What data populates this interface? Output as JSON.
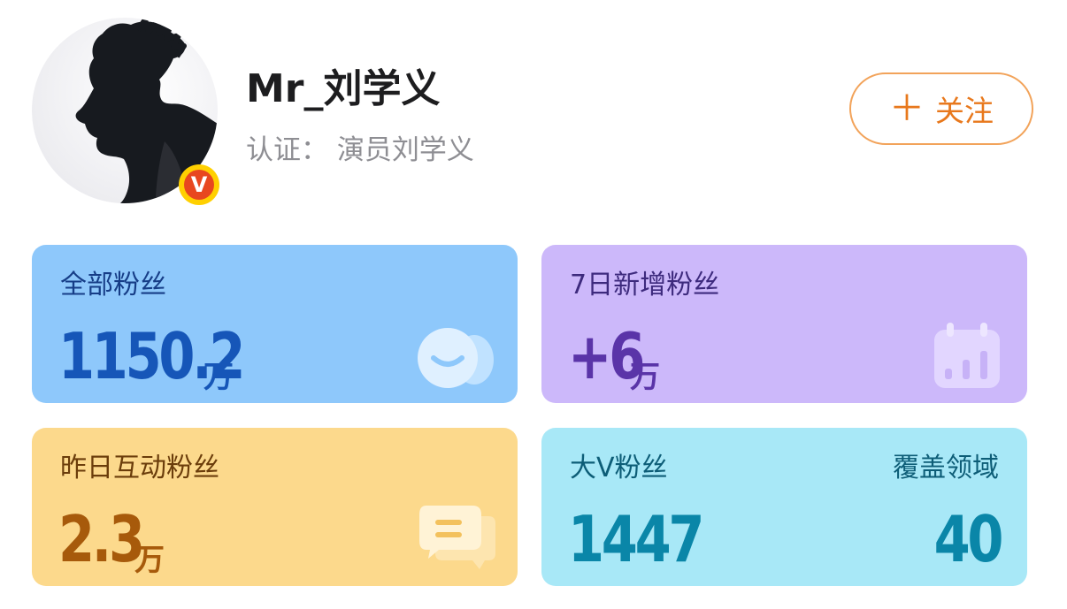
{
  "profile": {
    "name": "Mr_刘学义",
    "verification": "认证：  演员刘学义",
    "badge": "V",
    "follow_label": "关注",
    "follow_icon": "plus-icon"
  },
  "stats": {
    "total_fans": {
      "label": "全部粉丝",
      "value": "1150.2",
      "unit": "万",
      "icon": "smile-faces-icon"
    },
    "new_fans_7d": {
      "label": "7日新增粉丝",
      "value": "+6",
      "unit": "万",
      "icon": "calendar-chart-icon"
    },
    "active_fans_yesterday": {
      "label": "昨日互动粉丝",
      "value": "2.3",
      "unit": "万",
      "icon": "chat-bubble-icon"
    },
    "bigv_fans": {
      "label": "大V粉丝",
      "value": "1447",
      "coverage_label": "覆盖领域",
      "coverage_value": "40"
    }
  },
  "colors": {
    "card_blue": "#8ec8fb",
    "card_purple": "#ccb8fa",
    "card_yellow": "#fcd98c",
    "card_cyan": "#a8e8f7",
    "follow_accent": "#e8781c"
  }
}
